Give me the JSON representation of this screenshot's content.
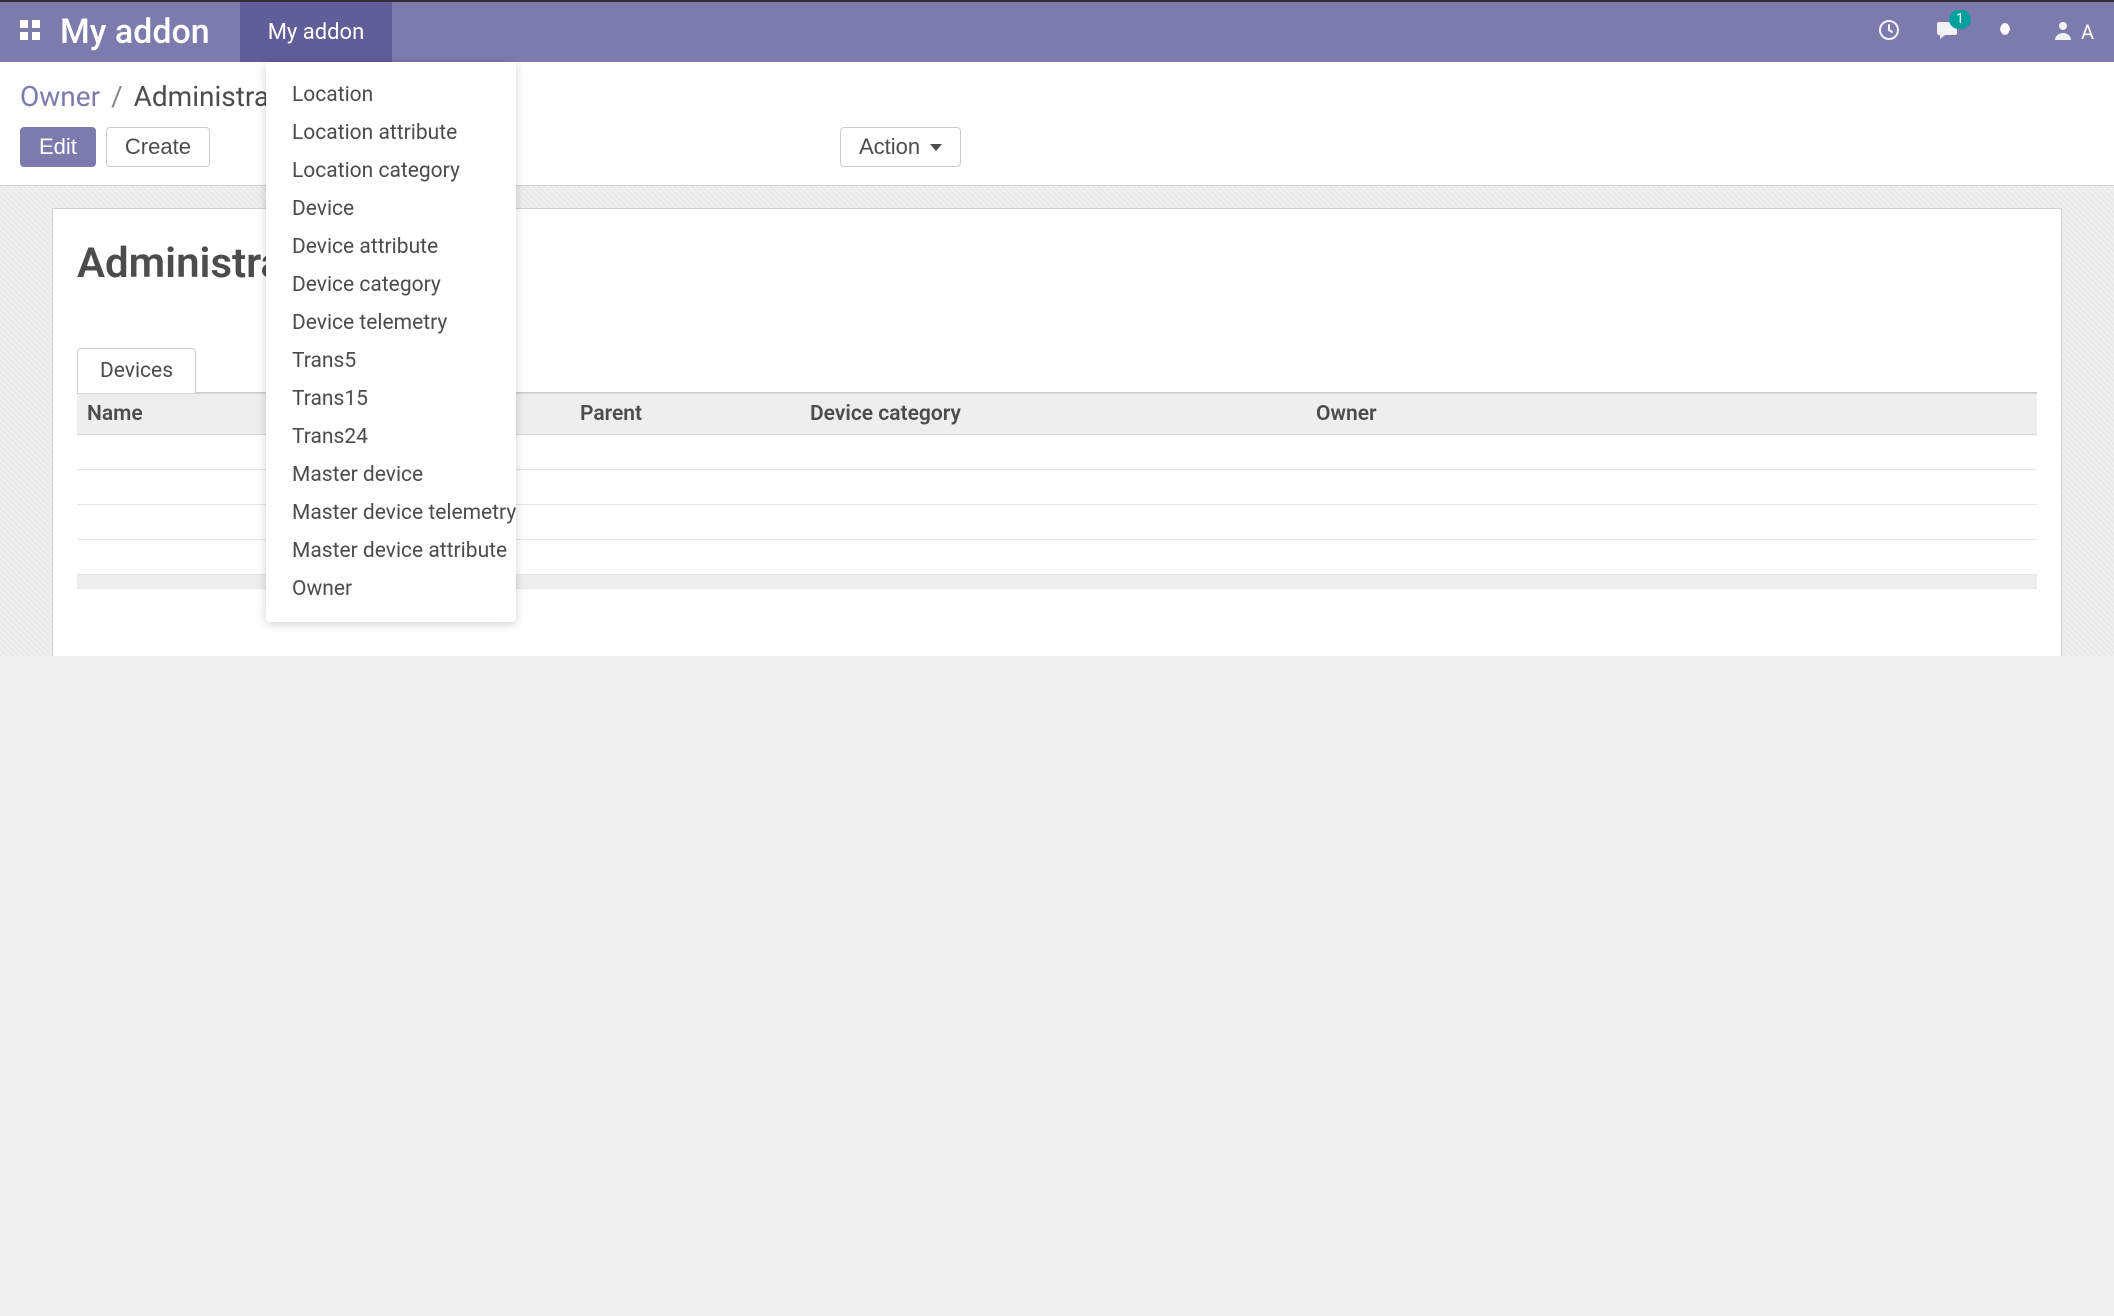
{
  "colors": {
    "primary": "#7c7bad",
    "primary_dark": "#5f5e97",
    "badge": "#00a09d"
  },
  "navbar": {
    "brand": "My addon",
    "menu": [
      {
        "label": "My addon",
        "active": true
      }
    ],
    "messaging_badge": "1",
    "user_initial": "A"
  },
  "dropdown": {
    "items": [
      "Location",
      "Location attribute",
      "Location category",
      "Device",
      "Device attribute",
      "Device category",
      "Device telemetry",
      "Trans5",
      "Trans15",
      "Trans24",
      "Master device",
      "Master device telemetry",
      "Master device attribute",
      "Owner"
    ]
  },
  "breadcrumb": {
    "root": "Owner",
    "current": "Administrator"
  },
  "buttons": {
    "edit": "Edit",
    "create": "Create",
    "action": "Action"
  },
  "form": {
    "title": "Administrator",
    "tabs": [
      {
        "label": "Devices",
        "active": true
      }
    ],
    "table": {
      "columns": [
        "Name",
        "Parent",
        "Device category",
        "Owner"
      ],
      "rows": [
        {},
        {},
        {},
        {}
      ]
    }
  }
}
